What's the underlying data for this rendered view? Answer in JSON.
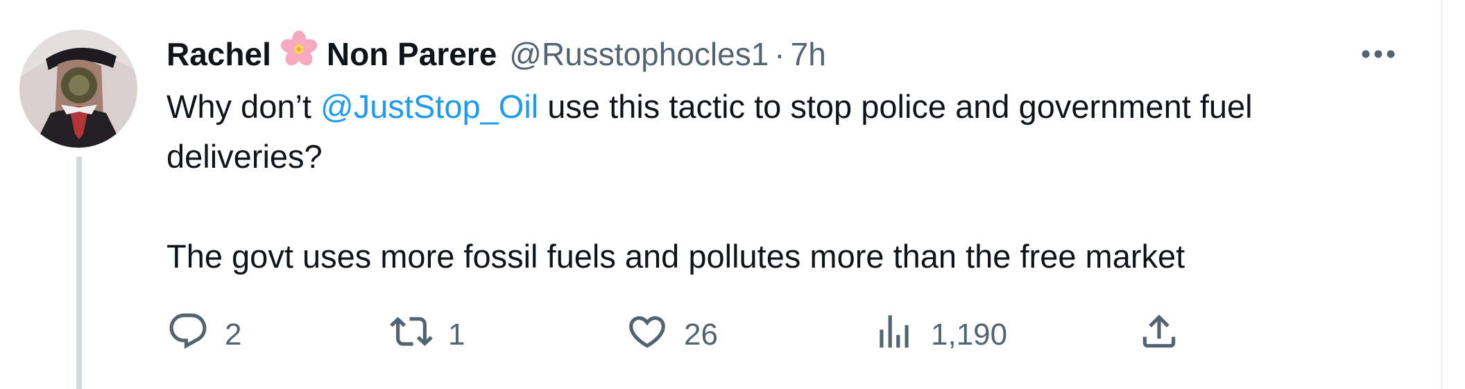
{
  "tweet": {
    "author": {
      "display_name_first": "Rachel",
      "display_name_emoji": "cherry-blossom",
      "display_name_last": "Non Parere",
      "handle": "@Russtophocles1",
      "separator": "·",
      "time": "7h"
    },
    "body": {
      "line1_prefix": "Why don’t ",
      "mention": "@JustStop_Oil",
      "line1_suffix": " use this tactic to stop police and government fuel deliveries?",
      "paragraph2": "The govt uses more fossil fuels and pollutes more than the free market"
    },
    "actions": {
      "replies": "2",
      "retweets": "1",
      "likes": "26",
      "views": "1,190"
    }
  },
  "icons": [
    "avatar",
    "cherry-blossom-icon",
    "more-icon",
    "reply-icon",
    "retweet-icon",
    "like-icon",
    "views-icon",
    "share-icon"
  ],
  "colors": {
    "text_primary": "#0f1419",
    "text_secondary": "#536471",
    "mention": "#1d9bf0",
    "thread_line": "#cfd9de"
  }
}
